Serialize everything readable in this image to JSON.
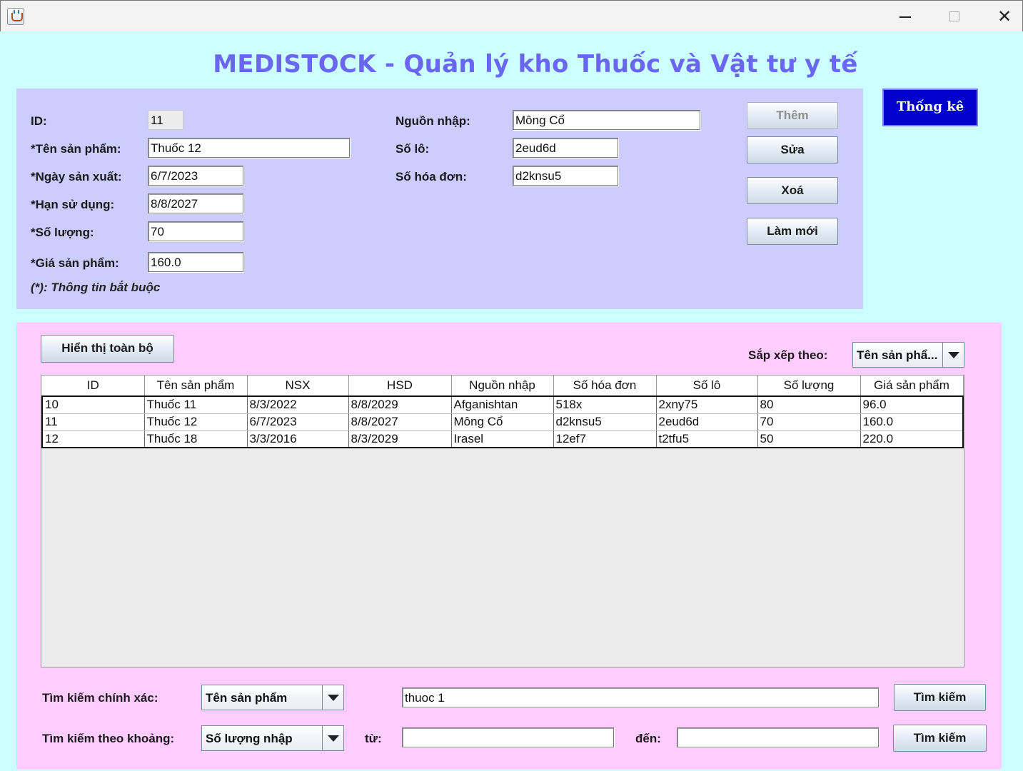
{
  "window": {
    "title_icon": "java-cup-icon",
    "minimize": "minimize-icon",
    "maximize": "maximize-icon",
    "close_glyph": "✕"
  },
  "app_title": "MEDISTOCK - Quản lý kho Thuốc và Vật tư y tế",
  "form": {
    "id_label": "ID:",
    "id_value": "11",
    "name_label": "*Tên sản phẩm:",
    "name_value": "Thuốc 12",
    "mfg_label": "*Ngày sản xuất:",
    "mfg_value": "6/7/2023",
    "exp_label": "*Hạn sử dụng:",
    "exp_value": "8/8/2027",
    "qty_label": "*Số lượng:",
    "qty_value": "70",
    "price_label": "*Giá sản phẩm:",
    "price_value": "160.0",
    "required_note": "(*): Thông tin bắt buộc",
    "source_label": "Nguồn nhập:",
    "source_value": "Mông Cổ",
    "lot_label": "Số lô:",
    "lot_value": "2eud6d",
    "invoice_label": "Số hóa đơn:",
    "invoice_value": "d2knsu5"
  },
  "actions": {
    "add": "Thêm",
    "edit": "Sửa",
    "delete": "Xoá",
    "reset": "Làm mới",
    "stats": "Thống kê"
  },
  "list": {
    "show_all": "Hiển thị toàn bộ",
    "sort_label": "Sắp xếp theo:",
    "sort_value": "Tên sản phẩ...",
    "columns": [
      "ID",
      "Tên sản phẩm",
      "NSX",
      "HSD",
      "Nguồn nhập",
      "Số hóa đơn",
      "Số lô",
      "Số lượng",
      "Giá sản phẩm"
    ],
    "rows": [
      [
        "10",
        "Thuốc 11",
        "8/3/2022",
        "8/8/2029",
        "Afganishtan",
        "518x",
        "2xny75",
        "80",
        "96.0"
      ],
      [
        "11",
        "Thuốc 12",
        "6/7/2023",
        "8/8/2027",
        "Mông Cổ",
        "d2knsu5",
        "2eud6d",
        "70",
        "160.0"
      ],
      [
        "12",
        "Thuốc 18",
        "3/3/2016",
        "8/3/2029",
        "Irasel",
        "12ef7",
        "t2tfu5",
        "50",
        "220.0"
      ]
    ]
  },
  "search": {
    "exact_label": "Tìm kiếm chính xác:",
    "exact_field": "Tên sản phẩm",
    "exact_query": "thuoc 1",
    "exact_button": "Tìm kiếm",
    "range_label": "Tìm kiếm theo khoảng:",
    "range_field": "Số lượng nhập",
    "from_label": "từ:",
    "from_value": "",
    "to_label": "đến:",
    "to_value": "",
    "range_button": "Tìm kiếm"
  }
}
